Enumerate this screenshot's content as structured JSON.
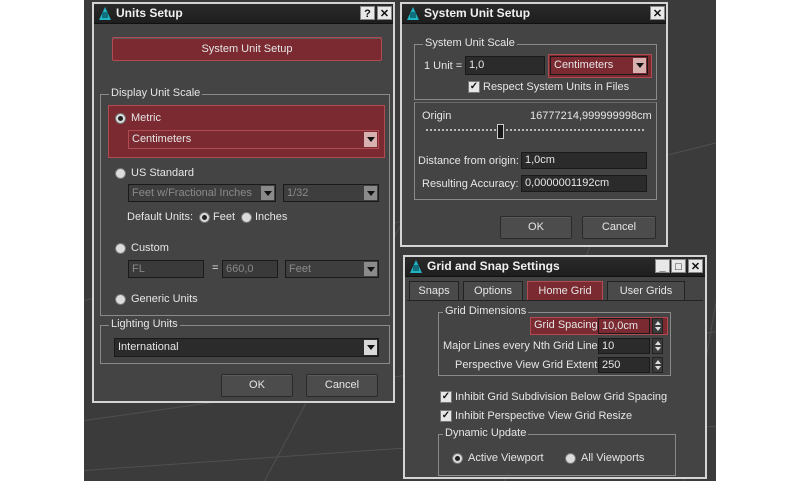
{
  "units_setup": {
    "title": "Units Setup",
    "system_unit_setup_button": "System Unit Setup",
    "display_unit_scale_label": "Display Unit Scale",
    "metric_label": "Metric",
    "metric_value": "Centimeters",
    "us_standard_label": "US Standard",
    "us_value": "Feet w/Fractional Inches",
    "us_fraction": "1/32",
    "default_units_label": "Default Units:",
    "feet_label": "Feet",
    "inches_label": "Inches",
    "custom_label": "Custom",
    "custom_name": "FL",
    "custom_equals": "=",
    "custom_value": "660,0",
    "custom_unit": "Feet",
    "generic_units_label": "Generic Units",
    "lighting_units_label": "Lighting Units",
    "lighting_value": "International",
    "ok": "OK",
    "cancel": "Cancel"
  },
  "system_unit_setup": {
    "title": "System Unit Setup",
    "scale_label": "System Unit Scale",
    "one_unit_label": "1 Unit =",
    "unit_value": "1,0",
    "unit_type": "Centimeters",
    "respect_label": "Respect System Units in Files",
    "origin_label": "Origin",
    "origin_value": "16777214,999999998cm",
    "distance_label": "Distance from origin:",
    "distance_value": "1,0cm",
    "accuracy_label": "Resulting Accuracy:",
    "accuracy_value": "0,0000001192cm",
    "ok": "OK",
    "cancel": "Cancel"
  },
  "grid_snap": {
    "title": "Grid and Snap Settings",
    "tabs": [
      "Snaps",
      "Options",
      "Home Grid",
      "User Grids"
    ],
    "grid_dimensions_label": "Grid Dimensions",
    "grid_spacing_label": "Grid Spacing:",
    "grid_spacing_value": "10,0cm",
    "major_lines_label": "Major Lines every Nth Grid Line:",
    "major_lines_value": "10",
    "perspective_label": "Perspective View Grid Extent:",
    "perspective_value": "250",
    "inhibit_subdivision_label": "Inhibit Grid Subdivision Below Grid Spacing",
    "inhibit_resize_label": "Inhibit Perspective View Grid Resize",
    "dynamic_update_label": "Dynamic Update",
    "active_viewport_label": "Active Viewport",
    "all_viewports_label": "All Viewports"
  }
}
